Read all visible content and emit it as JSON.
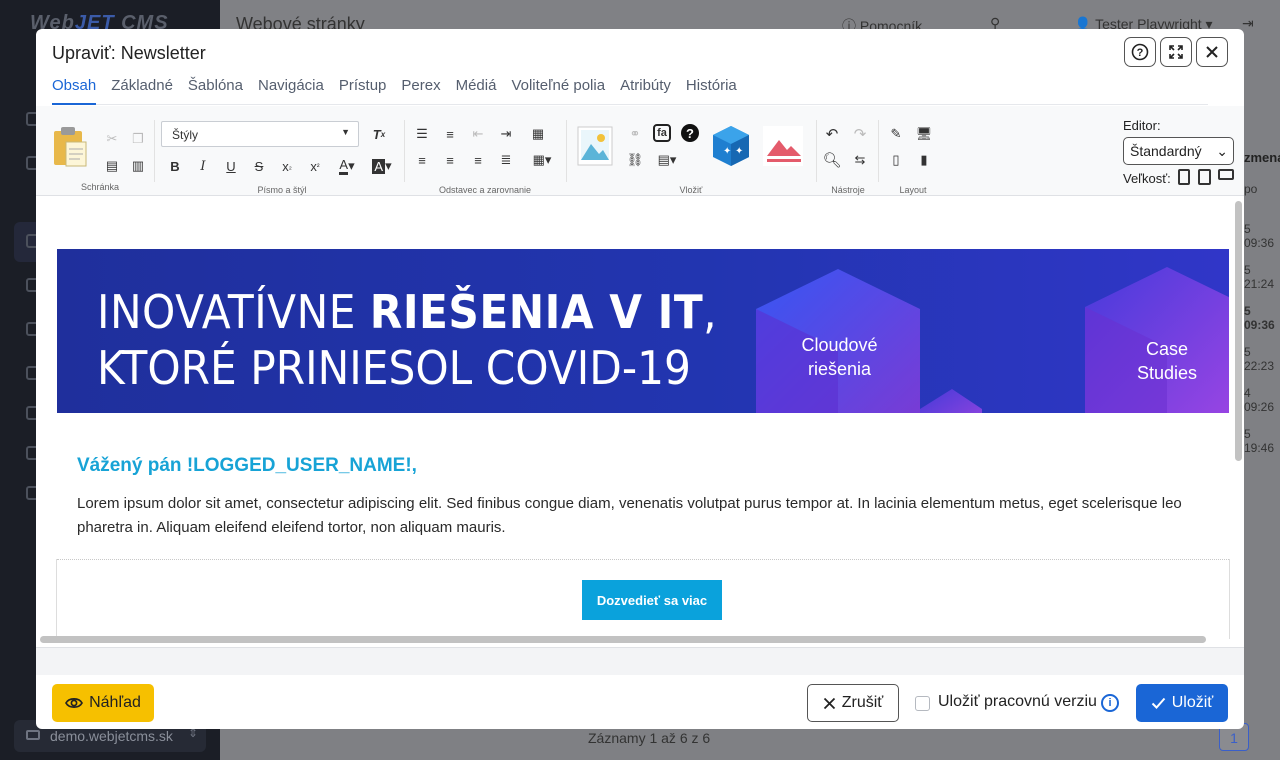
{
  "background": {
    "logo": "WebJET CMS",
    "page_title": "Webové stránky",
    "help_label": "Pomocník",
    "user_name": "Tester Playwright",
    "column_header": "zmena",
    "column_sub": "po",
    "cells": [
      "5 09:36",
      "5 21:24",
      "5 09:36",
      "5 22:23",
      "4 09:26",
      "5 19:46"
    ],
    "records_info": "Záznamy 1 až 6 z 6",
    "page_number": "1",
    "domain": "demo.webjetcms.sk"
  },
  "modal": {
    "title": "Upraviť: Newsletter",
    "tabs": [
      "Obsah",
      "Základné",
      "Šablóna",
      "Navigácia",
      "Prístup",
      "Perex",
      "Médiá",
      "Voliteľné polia",
      "Atribúty",
      "História"
    ],
    "active_tab": "Obsah"
  },
  "toolbar": {
    "groups": {
      "clipboard": "Schránka",
      "font": "Písmo a štýl",
      "paragraph": "Odstavec a zarovnanie",
      "insert": "Vložiť",
      "tools": "Nástroje",
      "layout": "Layout"
    },
    "styles_placeholder": "Štýly",
    "editor_label": "Editor:",
    "editor_value": "Štandardný",
    "size_label": "Veľkosť:"
  },
  "content": {
    "banner_line1_light": "INOVATÍVNE ",
    "banner_line1_bold": "RIEŠENIA V IT",
    "banner_line1_comma": ",",
    "banner_line2": "KTORÉ PRINIESOL COVID-19",
    "cube1_label": "Cloudové riešenia",
    "cube2_label": "Case Studies",
    "greeting": "Vážený pán !LOGGED_USER_NAME!,",
    "body": "Lorem ipsum dolor sit amet, consectetur adipiscing elit. Sed finibus congue diam, venenatis volutpat purus tempor at. In lacinia elementum metus, eget scelerisque leo pharetra in. Aliquam eleifend eleifend tortor, non aliquam mauris.",
    "cta": "Dozvedieť sa viac"
  },
  "footer": {
    "preview": "Náhľad",
    "cancel": "Zrušiť",
    "save_draft": "Uložiť pracovnú verziu",
    "save": "Uložiť"
  },
  "colors": {
    "accent": "#1a66d6",
    "preview_button": "#f6c000",
    "greeting": "#17a3d6",
    "cta": "#0aa2dc",
    "banner": "#2235b0"
  }
}
